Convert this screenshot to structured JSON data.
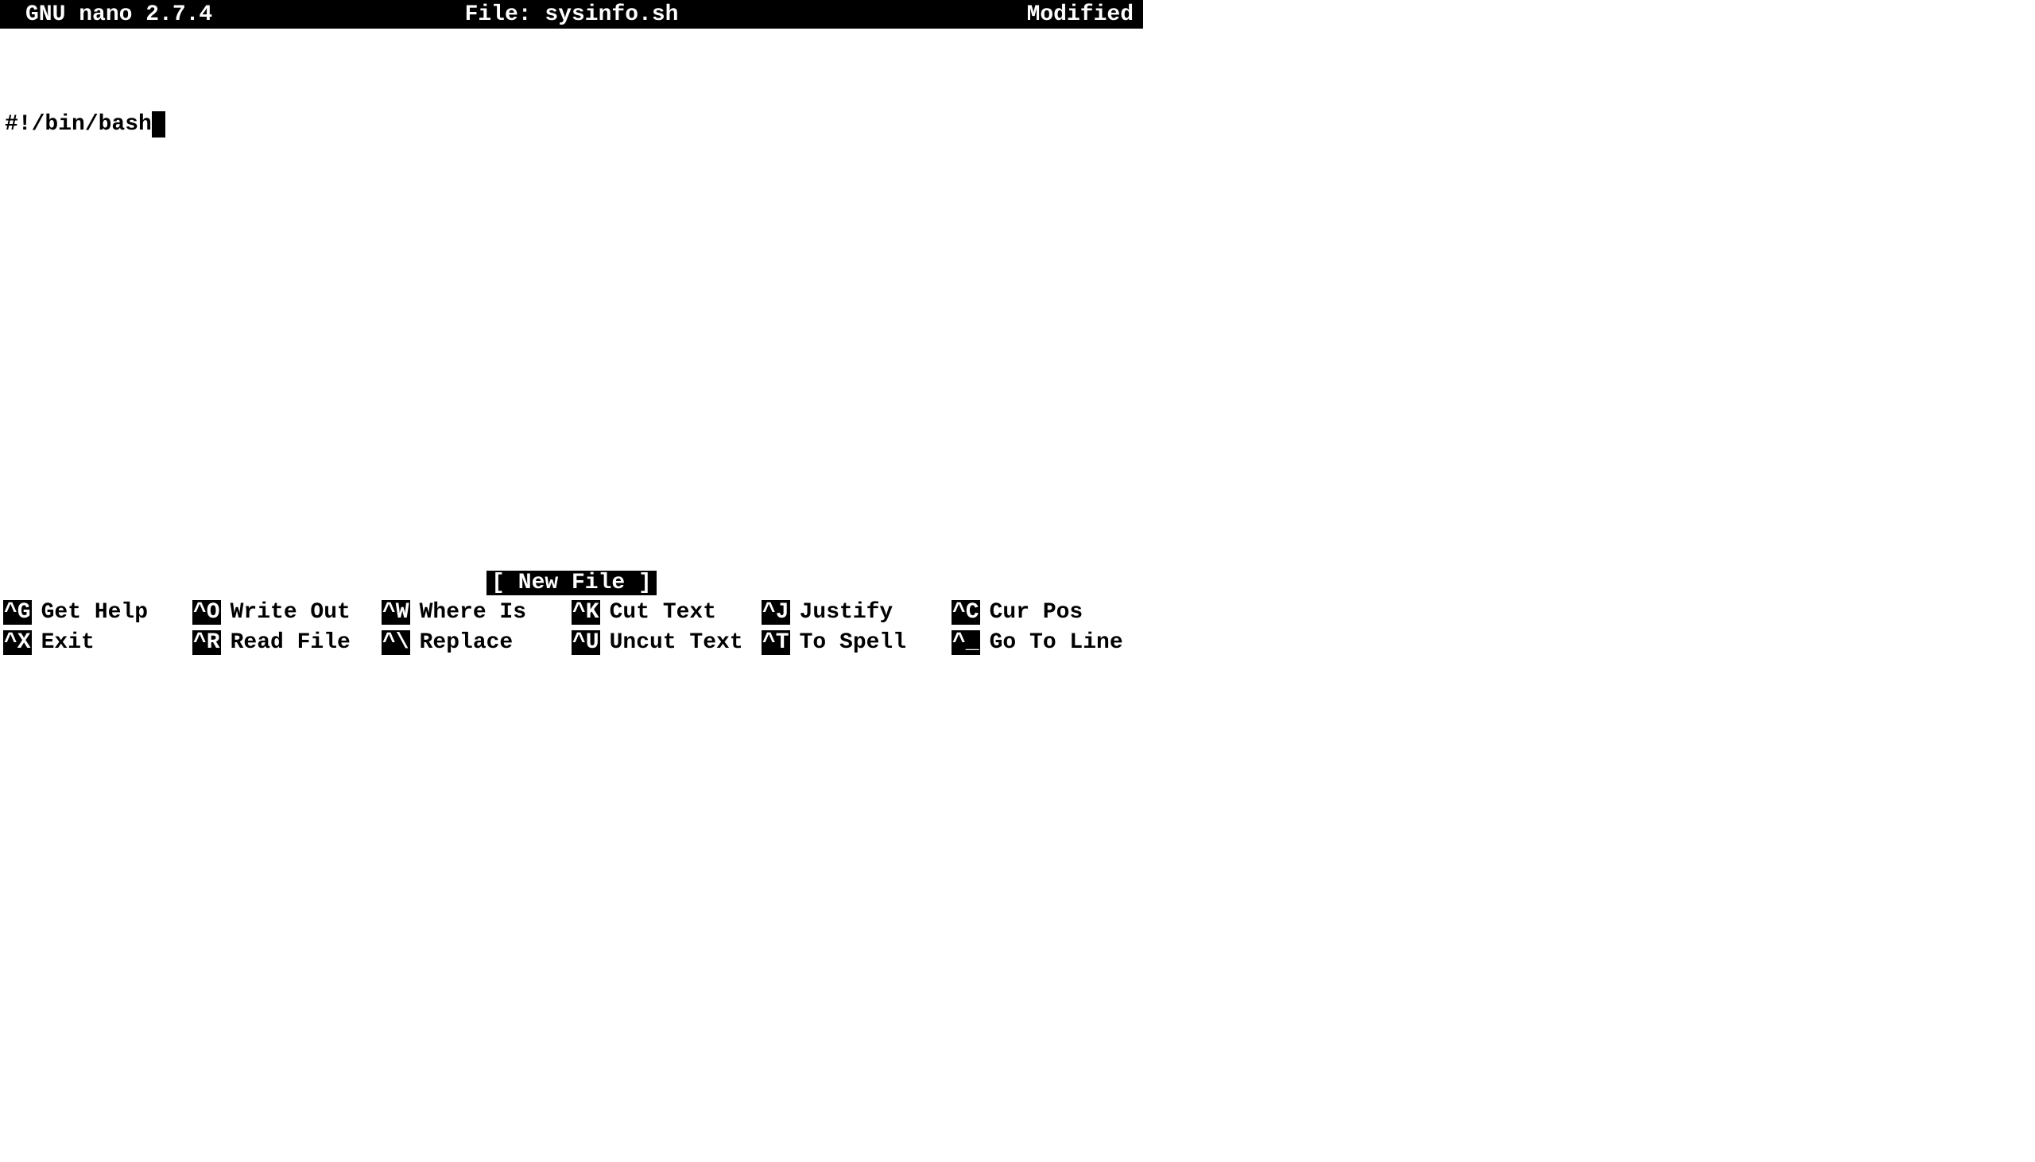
{
  "titlebar": {
    "app_version": "GNU nano 2.7.4",
    "file_label": "File: sysinfo.sh",
    "status": "Modified"
  },
  "editor": {
    "line1": "#!/bin/bash"
  },
  "status_message": "[ New File ]",
  "shortcuts": {
    "row1": [
      {
        "key": "^G",
        "label": "Get Help"
      },
      {
        "key": "^O",
        "label": "Write Out"
      },
      {
        "key": "^W",
        "label": "Where Is"
      },
      {
        "key": "^K",
        "label": "Cut Text"
      },
      {
        "key": "^J",
        "label": "Justify"
      },
      {
        "key": "^C",
        "label": "Cur Pos"
      }
    ],
    "row2": [
      {
        "key": "^X",
        "label": "Exit"
      },
      {
        "key": "^R",
        "label": "Read File"
      },
      {
        "key": "^\\",
        "label": "Replace"
      },
      {
        "key": "^U",
        "label": "Uncut Text"
      },
      {
        "key": "^T",
        "label": "To Spell"
      },
      {
        "key": "^_",
        "label": "Go To Line"
      }
    ]
  }
}
